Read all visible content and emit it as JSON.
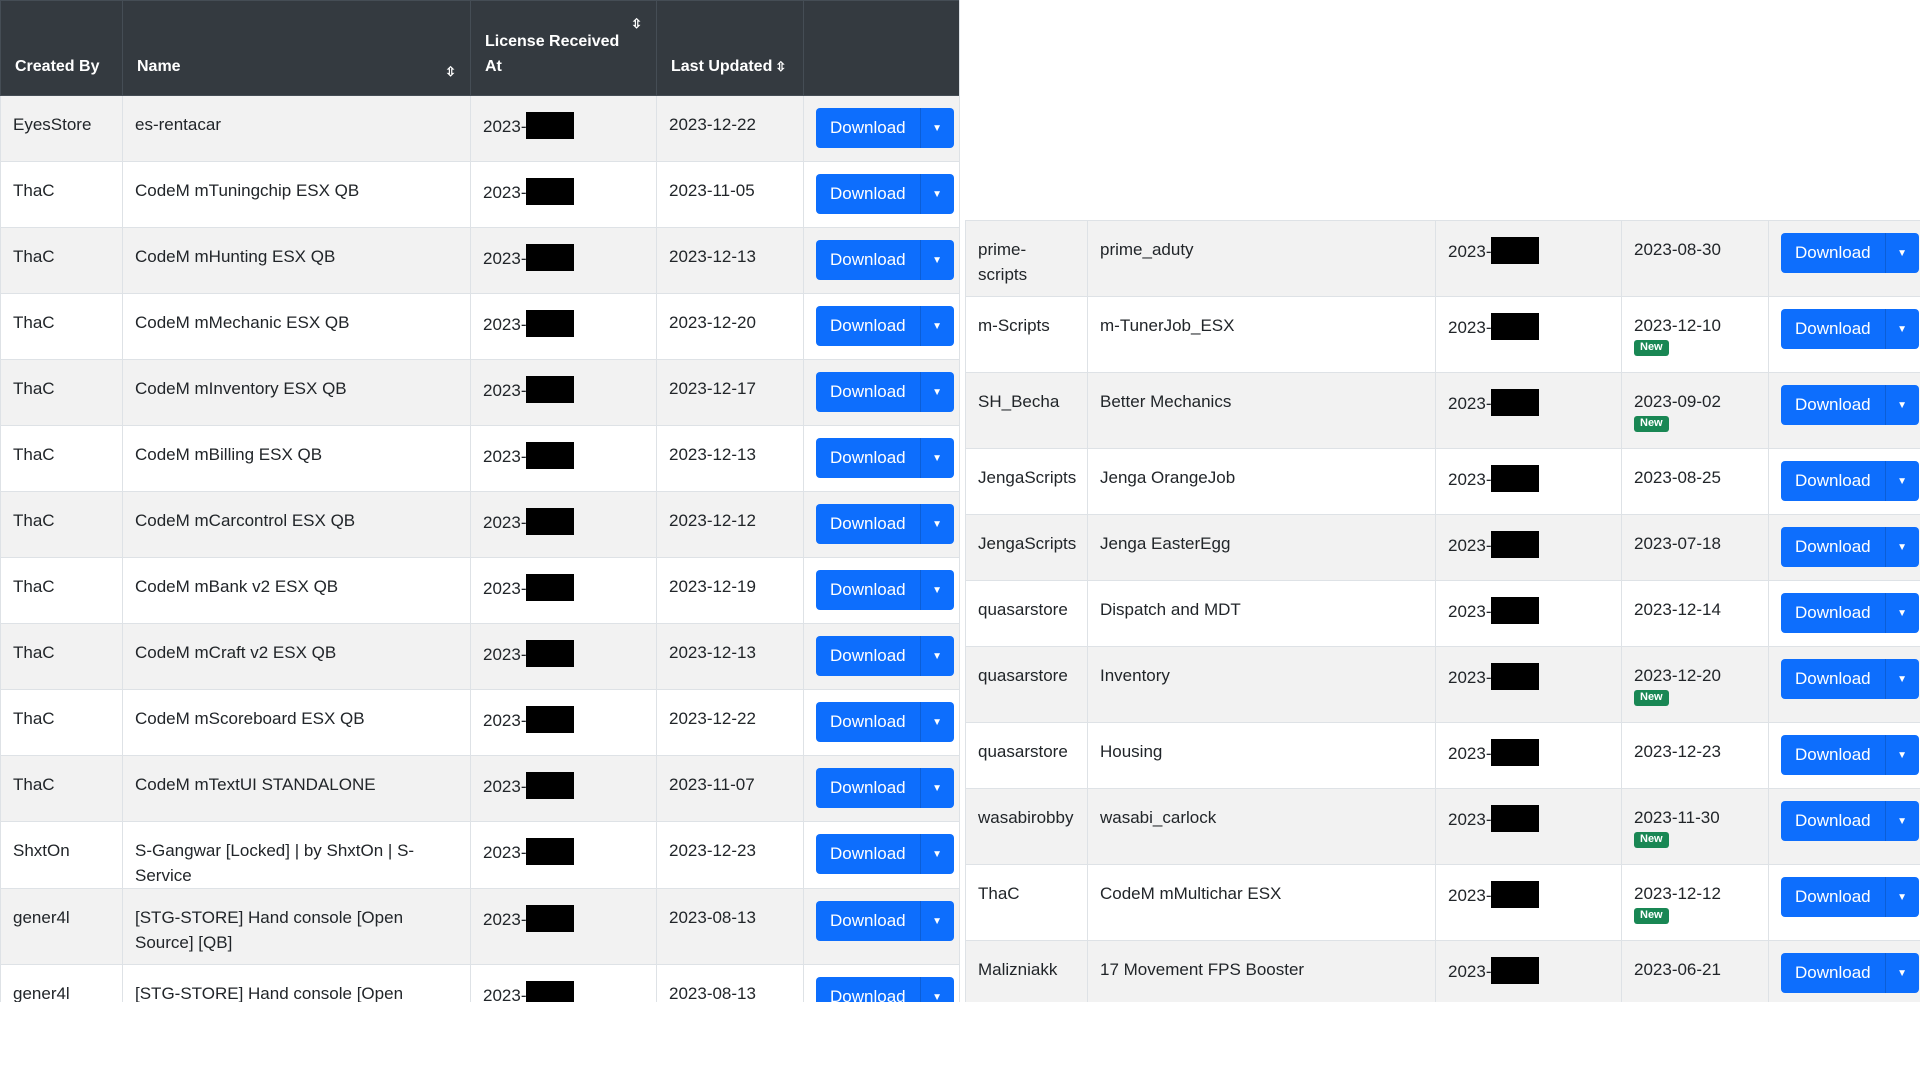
{
  "left_table": {
    "headers": {
      "created_by": "Created By",
      "name": "Name",
      "license_received_at": "License Received At",
      "last_updated": "Last Updated"
    },
    "rows": [
      {
        "created_by": "EyesStore",
        "name": "es-rentacar",
        "license": "2023-",
        "updated": "2023-12-22",
        "is_new": false
      },
      {
        "created_by": "ThaC",
        "name": "CodeM mTuningchip ESX QB",
        "license": "2023-",
        "updated": "2023-11-05",
        "is_new": false
      },
      {
        "created_by": "ThaC",
        "name": "CodeM mHunting ESX QB",
        "license": "2023-",
        "updated": "2023-12-13",
        "is_new": false
      },
      {
        "created_by": "ThaC",
        "name": "CodeM mMechanic ESX QB",
        "license": "2023-",
        "updated": "2023-12-20",
        "is_new": false
      },
      {
        "created_by": "ThaC",
        "name": "CodeM mInventory ESX QB",
        "license": "2023-",
        "updated": "2023-12-17",
        "is_new": false
      },
      {
        "created_by": "ThaC",
        "name": "CodeM mBilling ESX QB",
        "license": "2023-",
        "updated": "2023-12-13",
        "is_new": false
      },
      {
        "created_by": "ThaC",
        "name": "CodeM mCarcontrol ESX QB",
        "license": "2023-",
        "updated": "2023-12-12",
        "is_new": false
      },
      {
        "created_by": "ThaC",
        "name": "CodeM mBank v2 ESX QB",
        "license": "2023-",
        "updated": "2023-12-19",
        "is_new": false
      },
      {
        "created_by": "ThaC",
        "name": "CodeM mCraft v2 ESX QB",
        "license": "2023-",
        "updated": "2023-12-13",
        "is_new": false
      },
      {
        "created_by": "ThaC",
        "name": "CodeM mScoreboard ESX QB",
        "license": "2023-",
        "updated": "2023-12-22",
        "is_new": false
      },
      {
        "created_by": "ThaC",
        "name": "CodeM mTextUI STANDALONE",
        "license": "2023-",
        "updated": "2023-11-07",
        "is_new": false
      },
      {
        "created_by": "ShxtOn",
        "name": "S-Gangwar [Locked] | by ShxtOn | S-Service",
        "license": "2023-",
        "updated": "2023-12-23",
        "is_new": false
      },
      {
        "created_by": "gener4l",
        "name": "[STG-STORE] Hand console [Open Source] [QB]",
        "license": "2023-",
        "updated": "2023-08-13",
        "is_new": false
      },
      {
        "created_by": "gener4l",
        "name": "[STG-STORE] Hand console [Open Source] [ESX]",
        "license": "2023-",
        "updated": "2023-08-13",
        "is_new": false
      }
    ]
  },
  "right_table": {
    "rows": [
      {
        "created_by": "prime-scripts",
        "name": "prime_aduty",
        "license": "2023-",
        "updated": "2023-08-30",
        "is_new": false
      },
      {
        "created_by": "m-Scripts",
        "name": "m-TunerJob_ESX",
        "license": "2023-",
        "updated": "2023-12-10",
        "is_new": true
      },
      {
        "created_by": "SH_Becha",
        "name": "Better Mechanics",
        "license": "2023-",
        "updated": "2023-09-02",
        "is_new": true
      },
      {
        "created_by": "JengaScripts",
        "name": "Jenga OrangeJob",
        "license": "2023-",
        "updated": "2023-08-25",
        "is_new": false
      },
      {
        "created_by": "JengaScripts",
        "name": "Jenga EasterEgg",
        "license": "2023-",
        "updated": "2023-07-18",
        "is_new": false
      },
      {
        "created_by": "quasarstore",
        "name": "Dispatch and MDT",
        "license": "2023-",
        "updated": "2023-12-14",
        "is_new": false
      },
      {
        "created_by": "quasarstore",
        "name": "Inventory",
        "license": "2023-",
        "updated": "2023-12-20",
        "is_new": true
      },
      {
        "created_by": "quasarstore",
        "name": "Housing",
        "license": "2023-",
        "updated": "2023-12-23",
        "is_new": false
      },
      {
        "created_by": "wasabirobby",
        "name": "wasabi_carlock",
        "license": "2023-",
        "updated": "2023-11-30",
        "is_new": true
      },
      {
        "created_by": "ThaC",
        "name": "CodeM mMultichar ESX",
        "license": "2023-",
        "updated": "2023-12-12",
        "is_new": true
      },
      {
        "created_by": "Malizniakk",
        "name": "17 Movement FPS Booster",
        "license": "2023-",
        "updated": "2023-06-21",
        "is_new": false
      }
    ]
  },
  "labels": {
    "download": "Download",
    "new_badge": "New"
  },
  "icons": {
    "sort": "sort-icon",
    "caret": "caret-down-icon",
    "redaction": "redaction-block"
  },
  "colors": {
    "header_bg": "#343a40",
    "button_primary": "#0d6efd",
    "badge_new": "#198754",
    "stripe": "#f2f2f2"
  }
}
